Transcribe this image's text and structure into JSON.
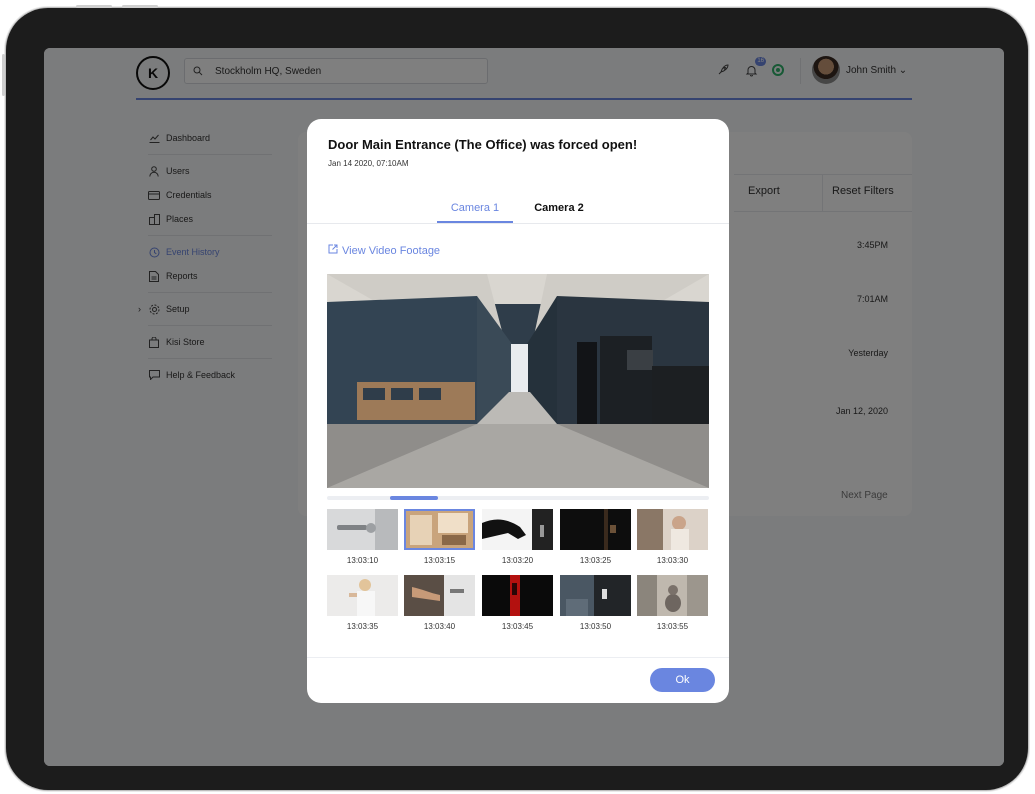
{
  "header": {
    "logo_letter": "K",
    "search_value": "Stockholm HQ, Sweden",
    "notification_count": "16",
    "user_name": "John Smith ⌄"
  },
  "sidebar": {
    "items": [
      {
        "label": "Dashboard",
        "icon": "chart-icon"
      },
      {
        "label": "Users",
        "icon": "user-icon"
      },
      {
        "label": "Credentials",
        "icon": "card-icon"
      },
      {
        "label": "Places",
        "icon": "building-icon"
      },
      {
        "label": "Event History",
        "icon": "history-icon",
        "active": true
      },
      {
        "label": "Reports",
        "icon": "report-icon"
      },
      {
        "label": "Setup",
        "icon": "gear-icon"
      },
      {
        "label": "Kisi Store",
        "icon": "bag-icon"
      },
      {
        "label": "Help & Feedback",
        "icon": "chat-icon"
      }
    ]
  },
  "background_table": {
    "export_label": "Export",
    "reset_label": "Reset Filters",
    "times": [
      "3:45PM",
      "7:01AM",
      "Yesterday",
      "Jan 12, 2020"
    ],
    "next_page": "Next Page"
  },
  "modal": {
    "title": "Door Main Entrance (The Office) was forced open!",
    "subtitle": "Jan 14 2020, 07:10AM",
    "tabs": [
      "Camera 1",
      "Camera 2"
    ],
    "video_link": "View Video Footage",
    "scrub_progress": 0.2,
    "thumbnails": [
      "13:03:10",
      "13:03:15",
      "13:03:20",
      "13:03:25",
      "13:03:30",
      "13:03:35",
      "13:03:40",
      "13:03:45",
      "13:03:50",
      "13:03:55"
    ],
    "selected_thumbnail": 1,
    "ok_label": "Ok"
  },
  "colors": {
    "accent": "#6a86e0",
    "status_online": "#2fb36b"
  }
}
